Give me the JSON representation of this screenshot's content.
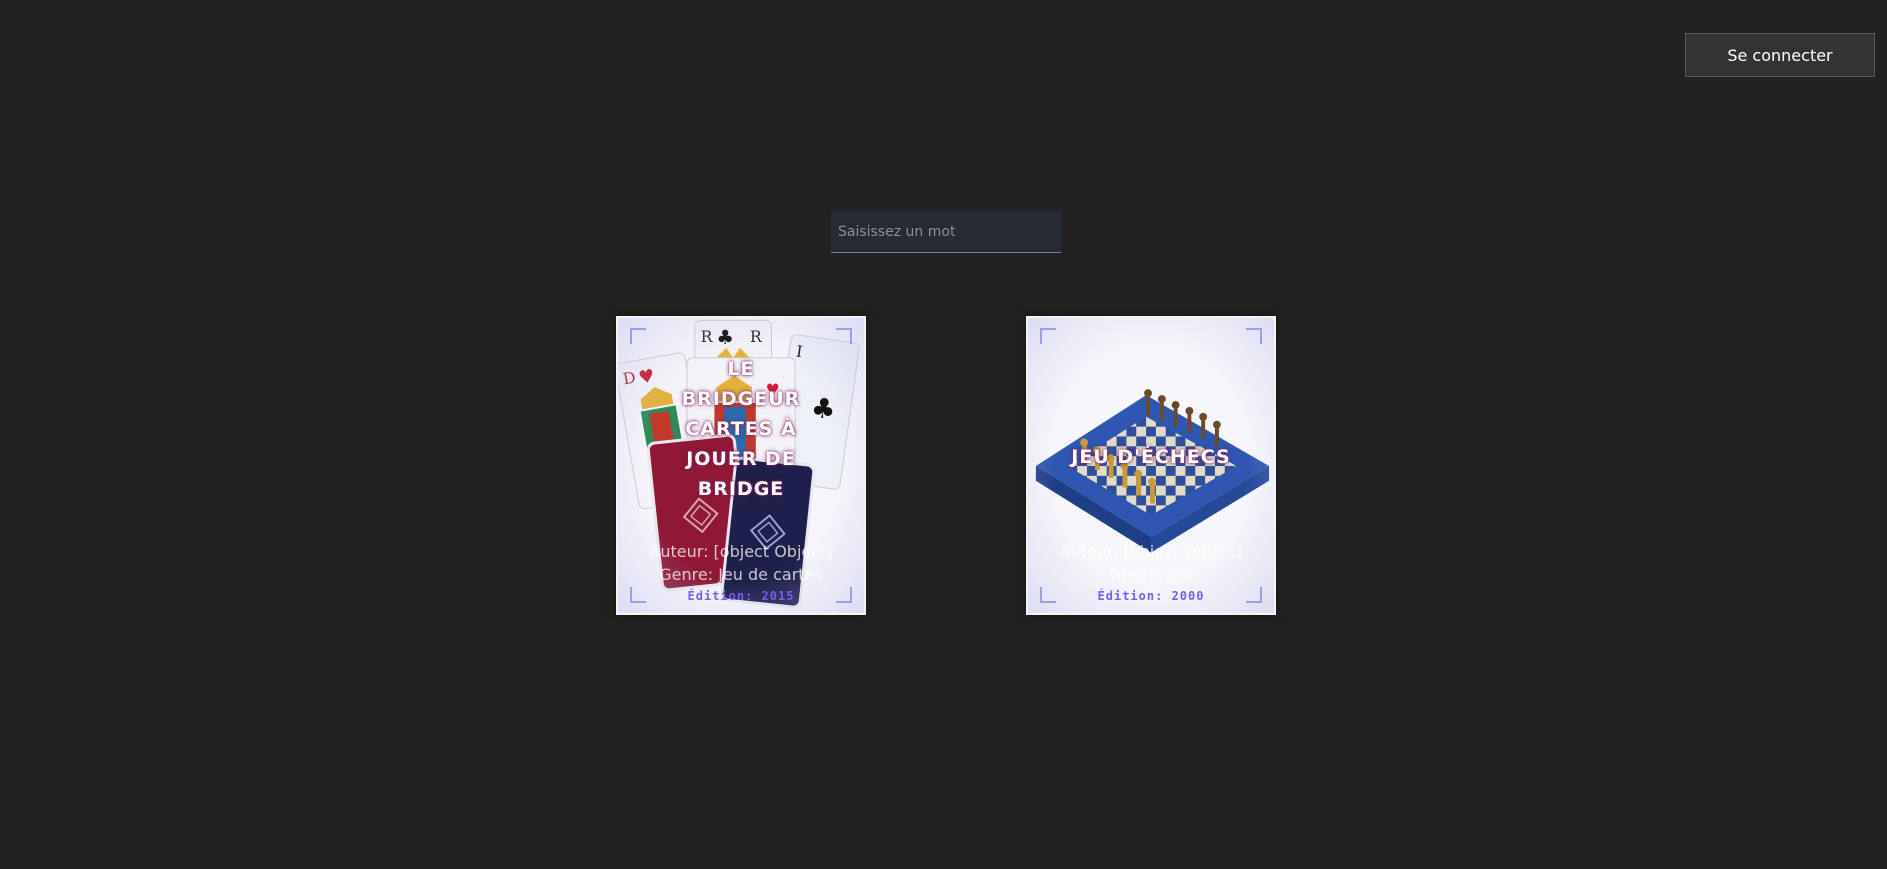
{
  "header": {
    "login_label": "Se connecter"
  },
  "search": {
    "placeholder": "Saisissez un mot",
    "value": ""
  },
  "cards": [
    {
      "title": "LE BRIDGEUR CARTES À JOUER DE BRIDGE",
      "author_line": "Auteur: [object Object]",
      "genre_line": "Genre: Jeu de cartes",
      "edition": "Édition: 2015",
      "image": "playing-cards"
    },
    {
      "title": "JEU D'ÉCHECS",
      "author_line": "Auteur: [object Object]",
      "genre_line": "Genre: Jeu",
      "edition": "Édition: 2000",
      "image": "chess-board"
    }
  ],
  "colors": {
    "background": "#212121",
    "edition_text": "#7a5cf0",
    "corner_marks": "#9aa0e6"
  }
}
